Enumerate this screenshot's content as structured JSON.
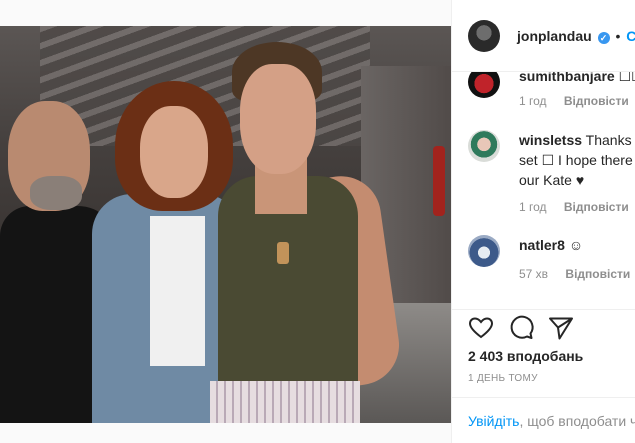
{
  "post": {
    "author": "jonplandau",
    "follow_label": "Стежити",
    "follow_separator": "•",
    "verified_icon": "verified-badge-icon"
  },
  "comments": [
    {
      "user": "sumithbanjare",
      "text": "☐☐",
      "time": "1 год",
      "reply": "Відповісти"
    },
    {
      "user": "winsletss",
      "text": "Thanks fo",
      "text_line2": "set ☐ I hope there a",
      "text_line3": "our Kate ♥",
      "time": "1 год",
      "reply": "Відповісти"
    },
    {
      "user": "natler8",
      "text": "☺",
      "time": "57 хв",
      "reply": "Відповісти"
    }
  ],
  "actions": {
    "like_icon": "heart-icon",
    "comment_icon": "comment-icon",
    "share_icon": "share-icon",
    "likes_text": "2 403 вподобань",
    "posted": "1 ДЕНЬ ТОМУ"
  },
  "login": {
    "link": "Увійдіть",
    "text": ", щоб вподобати ч"
  },
  "colors": {
    "accent": "#0095f6",
    "muted": "#8e8e8e",
    "text": "#262626",
    "border": "#efefef"
  }
}
